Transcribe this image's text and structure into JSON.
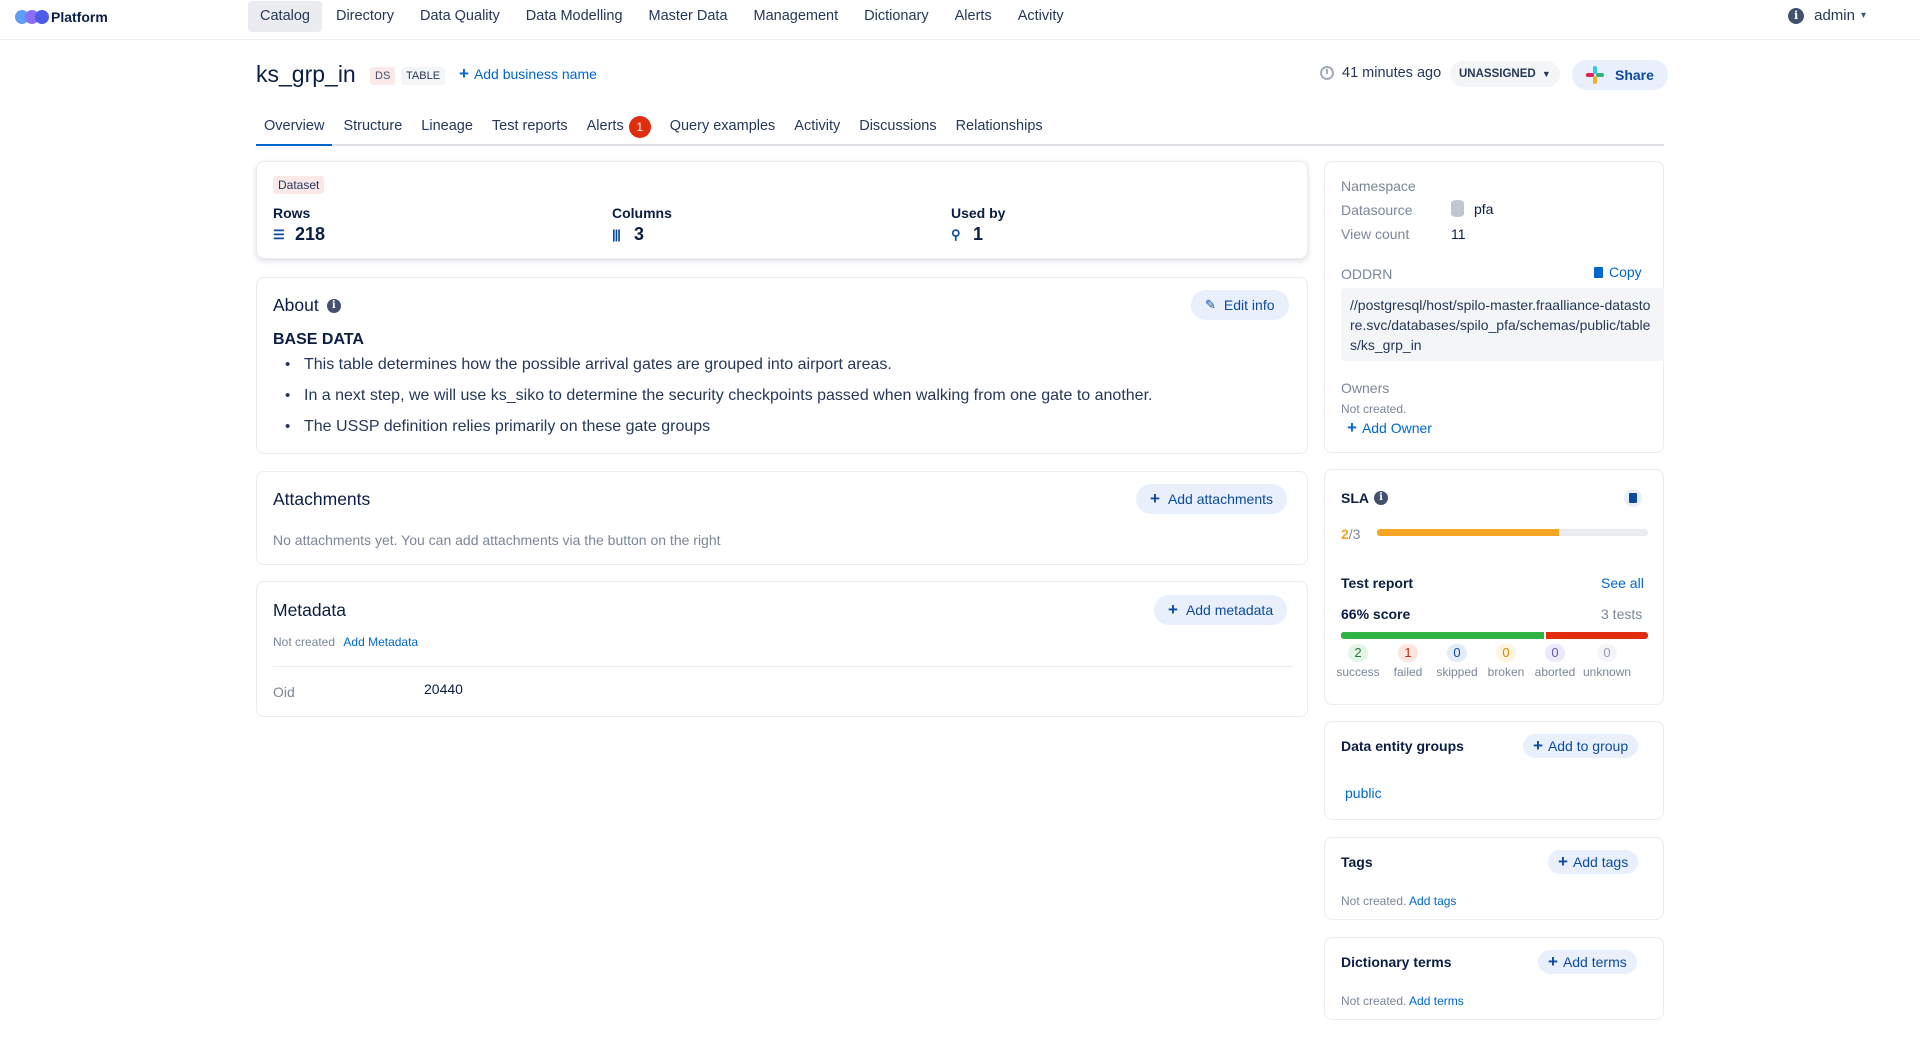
{
  "app": {
    "name": "Platform"
  },
  "nav": [
    "Catalog",
    "Directory",
    "Data Quality",
    "Data Modelling",
    "Master Data",
    "Management",
    "Dictionary",
    "Alerts",
    "Activity"
  ],
  "user": {
    "info_glyph": "i",
    "name": "admin"
  },
  "entity": {
    "name": "ks_grp_in",
    "source_chip": "DS",
    "type_chip": "TABLE",
    "add_business_name": "Add business name",
    "updated": "41 minutes ago",
    "status": "UNASSIGNED",
    "share": "Share"
  },
  "tabs": [
    {
      "label": "Overview"
    },
    {
      "label": "Structure"
    },
    {
      "label": "Lineage"
    },
    {
      "label": "Test reports"
    },
    {
      "label": "Alerts",
      "badge": "1"
    },
    {
      "label": "Query examples"
    },
    {
      "label": "Activity"
    },
    {
      "label": "Discussions"
    },
    {
      "label": "Relationships"
    }
  ],
  "stats": {
    "tag": "Dataset",
    "rows_label": "Rows",
    "rows": "218",
    "columns_label": "Columns",
    "columns": "3",
    "used_by_label": "Used by",
    "used_by": "1"
  },
  "about": {
    "title": "About",
    "info_glyph": "i",
    "edit": "Edit info",
    "heading": "BASE DATA",
    "bullets": [
      "This table determines how the possible arrival gates are grouped into airport areas.",
      "In a next step, we will use ks_siko to determine the security checkpoints passed when walking from one gate to another.",
      "The USSP definition relies primarily on these gate groups"
    ]
  },
  "attachments": {
    "title": "Attachments",
    "add": "Add attachments",
    "empty": "No attachments yet. You can add attachments via the button on the right"
  },
  "metadata": {
    "title": "Metadata",
    "add": "Add metadata",
    "not_created": "Not created",
    "add_link": "Add Metadata",
    "key": "Oid",
    "value": "20440"
  },
  "info": {
    "namespace_label": "Namespace",
    "datasource_label": "Datasource",
    "datasource": "pfa",
    "view_count_label": "View count",
    "view_count": "11",
    "oddrn_label": "ODDRN",
    "copy": "Copy",
    "oddrn": "//postgresql/host/spilo-master.fraalliance-datastore.svc/databases/spilo_pfa/schemas/public/tables/ks_grp_in",
    "owners_label": "Owners",
    "owners_empty": "Not created.",
    "add_owner": "Add Owner"
  },
  "sla": {
    "title": "SLA",
    "info_glyph": "i",
    "passed": "2",
    "total": "/3",
    "fraction": 0.67,
    "test_report": "Test report",
    "see_all": "See all",
    "score": "66% score",
    "tests": "3 tests",
    "success_fraction": 0.667,
    "results": [
      {
        "count": "2",
        "label": "success"
      },
      {
        "count": "1",
        "label": "failed"
      },
      {
        "count": "0",
        "label": "skipped"
      },
      {
        "count": "0",
        "label": "broken"
      },
      {
        "count": "0",
        "label": "aborted"
      },
      {
        "count": "0",
        "label": "unknown"
      }
    ]
  },
  "groups": {
    "title": "Data entity groups",
    "add": "Add to group",
    "item": "public"
  },
  "tags": {
    "title": "Tags",
    "add": "Add tags",
    "empty": "Not created.",
    "link": "Add tags"
  },
  "terms": {
    "title": "Dictionary terms",
    "add": "Add terms",
    "empty": "Not created.",
    "link": "Add terms"
  },
  "colors": {
    "accent": "#0066cc",
    "success": "#2fb344",
    "failed": "#e02d0e",
    "sla": "#f5a623"
  }
}
